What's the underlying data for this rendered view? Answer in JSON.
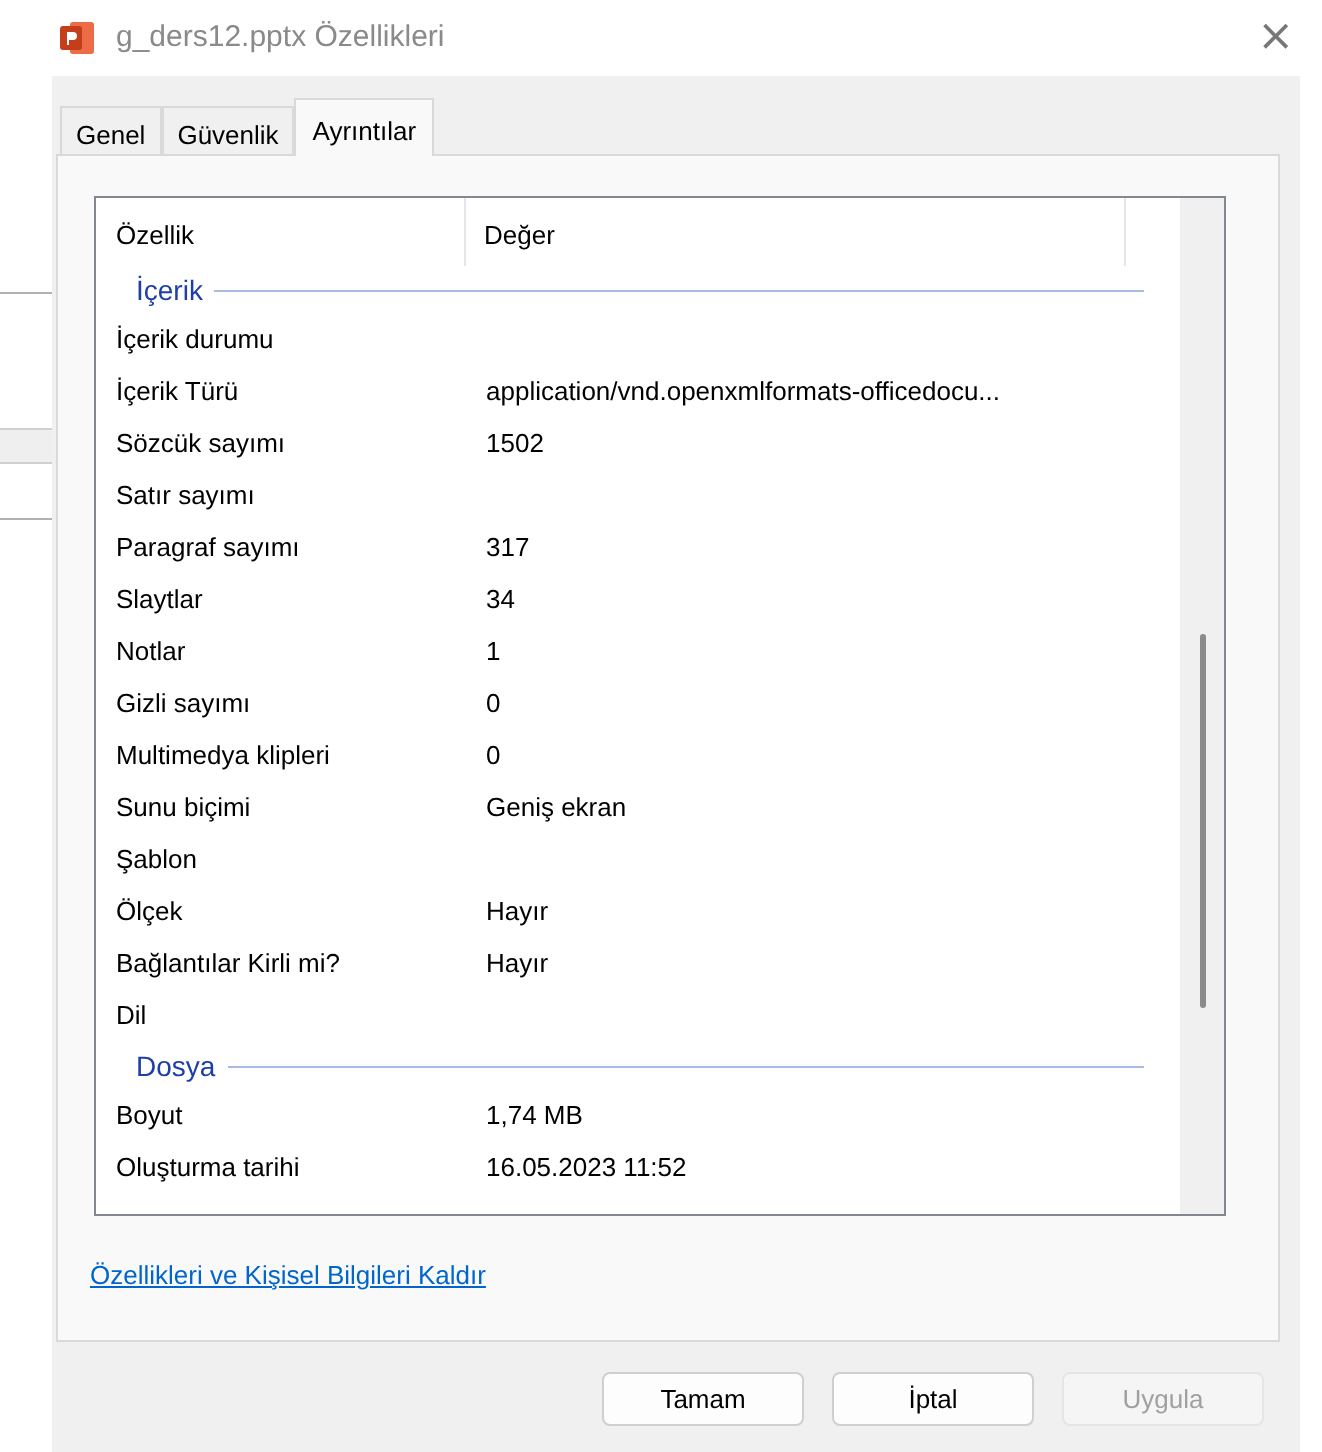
{
  "window": {
    "title": "g_ders12.pptx Özellikleri",
    "close": "×"
  },
  "tabs": [
    {
      "label": "Genel",
      "selected": false
    },
    {
      "label": "Güvenlik",
      "selected": false
    },
    {
      "label": "Ayrıntılar",
      "selected": true
    }
  ],
  "table": {
    "columns": [
      "Özellik",
      "Değer"
    ],
    "groups": [
      {
        "title": "İçerik",
        "rows": [
          {
            "property": "İçerik durumu",
            "value": ""
          },
          {
            "property": "İçerik Türü",
            "value": "application/vnd.openxmlformats-officedocu..."
          },
          {
            "property": "Sözcük sayımı",
            "value": "1502"
          },
          {
            "property": "Satır sayımı",
            "value": ""
          },
          {
            "property": "Paragraf sayımı",
            "value": "317"
          },
          {
            "property": "Slaytlar",
            "value": "34"
          },
          {
            "property": "Notlar",
            "value": "1"
          },
          {
            "property": "Gizli sayımı",
            "value": "0"
          },
          {
            "property": "Multimedya klipleri",
            "value": "0"
          },
          {
            "property": "Sunu biçimi",
            "value": "Geniş ekran"
          },
          {
            "property": "Şablon",
            "value": ""
          },
          {
            "property": "Ölçek",
            "value": "Hayır"
          },
          {
            "property": "Bağlantılar Kirli mi?",
            "value": "Hayır"
          },
          {
            "property": "Dil",
            "value": ""
          }
        ]
      },
      {
        "title": "Dosya",
        "rows": [
          {
            "property": "Boyut",
            "value": "1,74 MB"
          },
          {
            "property": "Oluşturma tarihi",
            "value": "16.05.2023 11:52"
          }
        ]
      }
    ]
  },
  "link": "Özellikleri ve Kişisel Bilgileri Kaldır",
  "buttons": [
    {
      "label": "Tamam",
      "disabled": false
    },
    {
      "label": "İptal",
      "disabled": false
    },
    {
      "label": "Uygula",
      "disabled": true
    }
  ]
}
